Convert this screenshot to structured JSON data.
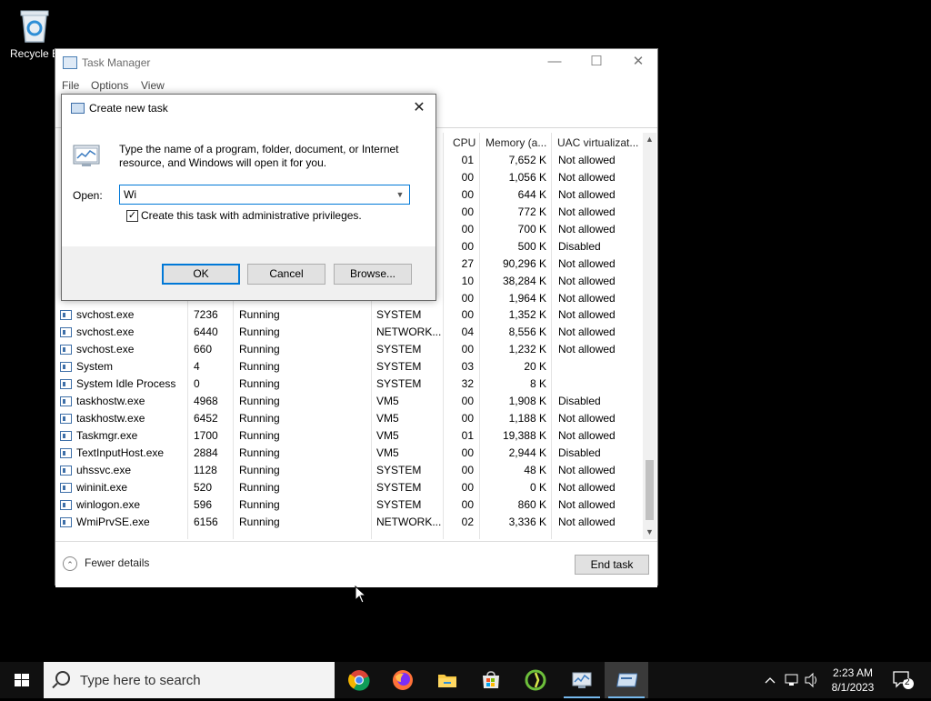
{
  "desktop": {
    "recycle_label": "Recycle B"
  },
  "task_manager": {
    "title": "Task Manager",
    "menu": [
      "File",
      "Options",
      "View"
    ],
    "columns": {
      "cpu": "CPU",
      "memory": "Memory (a...",
      "uac": "UAC virtualizat..."
    },
    "rows_top": [
      {
        "cpu": "01",
        "mem": "7,652 K",
        "uac": "Not allowed"
      },
      {
        "cpu": "00",
        "mem": "1,056 K",
        "uac": "Not allowed"
      },
      {
        "cpu": "00",
        "mem": "644 K",
        "uac": "Not allowed"
      },
      {
        "cpu": "00",
        "mem": "772 K",
        "uac": "Not allowed"
      },
      {
        "cpu": "00",
        "mem": "700 K",
        "uac": "Not allowed"
      },
      {
        "cpu": "00",
        "mem": "500 K",
        "uac": "Disabled"
      },
      {
        "cpu": "27",
        "mem": "90,296 K",
        "uac": "Not allowed"
      },
      {
        "cpu": "10",
        "mem": "38,284 K",
        "uac": "Not allowed"
      },
      {
        "cpu": "00",
        "mem": "1,964 K",
        "uac": "Not allowed"
      }
    ],
    "rows": [
      {
        "name": "svchost.exe",
        "pid": "7236",
        "status": "Running",
        "user": "SYSTEM",
        "cpu": "00",
        "mem": "1,352 K",
        "uac": "Not allowed"
      },
      {
        "name": "svchost.exe",
        "pid": "6440",
        "status": "Running",
        "user": "NETWORK...",
        "cpu": "04",
        "mem": "8,556 K",
        "uac": "Not allowed"
      },
      {
        "name": "svchost.exe",
        "pid": "660",
        "status": "Running",
        "user": "SYSTEM",
        "cpu": "00",
        "mem": "1,232 K",
        "uac": "Not allowed"
      },
      {
        "name": "System",
        "pid": "4",
        "status": "Running",
        "user": "SYSTEM",
        "cpu": "03",
        "mem": "20 K",
        "uac": ""
      },
      {
        "name": "System Idle Process",
        "pid": "0",
        "status": "Running",
        "user": "SYSTEM",
        "cpu": "32",
        "mem": "8 K",
        "uac": ""
      },
      {
        "name": "taskhostw.exe",
        "pid": "4968",
        "status": "Running",
        "user": "VM5",
        "cpu": "00",
        "mem": "1,908 K",
        "uac": "Disabled"
      },
      {
        "name": "taskhostw.exe",
        "pid": "6452",
        "status": "Running",
        "user": "VM5",
        "cpu": "00",
        "mem": "1,188 K",
        "uac": "Not allowed"
      },
      {
        "name": "Taskmgr.exe",
        "pid": "1700",
        "status": "Running",
        "user": "VM5",
        "cpu": "01",
        "mem": "19,388 K",
        "uac": "Not allowed"
      },
      {
        "name": "TextInputHost.exe",
        "pid": "2884",
        "status": "Running",
        "user": "VM5",
        "cpu": "00",
        "mem": "2,944 K",
        "uac": "Disabled"
      },
      {
        "name": "uhssvc.exe",
        "pid": "1128",
        "status": "Running",
        "user": "SYSTEM",
        "cpu": "00",
        "mem": "48 K",
        "uac": "Not allowed"
      },
      {
        "name": "wininit.exe",
        "pid": "520",
        "status": "Running",
        "user": "SYSTEM",
        "cpu": "00",
        "mem": "0 K",
        "uac": "Not allowed"
      },
      {
        "name": "winlogon.exe",
        "pid": "596",
        "status": "Running",
        "user": "SYSTEM",
        "cpu": "00",
        "mem": "860 K",
        "uac": "Not allowed"
      },
      {
        "name": "WmiPrvSE.exe",
        "pid": "6156",
        "status": "Running",
        "user": "NETWORK...",
        "cpu": "02",
        "mem": "3,336 K",
        "uac": "Not allowed"
      }
    ],
    "fewer_details": "Fewer details",
    "end_task": "End task"
  },
  "dialog": {
    "title": "Create new task",
    "description": "Type the name of a program, folder, document, or Internet resource, and Windows will open it for you.",
    "open_label": "Open:",
    "open_value": "Wi",
    "admin_label": "Create this task with administrative privileges.",
    "admin_checked": true,
    "ok": "OK",
    "cancel": "Cancel",
    "browse": "Browse..."
  },
  "taskbar": {
    "search_placeholder": "Type here to search",
    "apps": [
      "chrome-icon",
      "firefox-icon",
      "file-explorer-icon",
      "store-icon",
      "app-green-icon",
      "task-manager-icon",
      "run-dialog-icon"
    ],
    "time": "2:23 AM",
    "date": "8/1/2023",
    "notification_count": "2"
  },
  "colors": {
    "accent": "#0078d7",
    "taskbar": "#101010"
  }
}
